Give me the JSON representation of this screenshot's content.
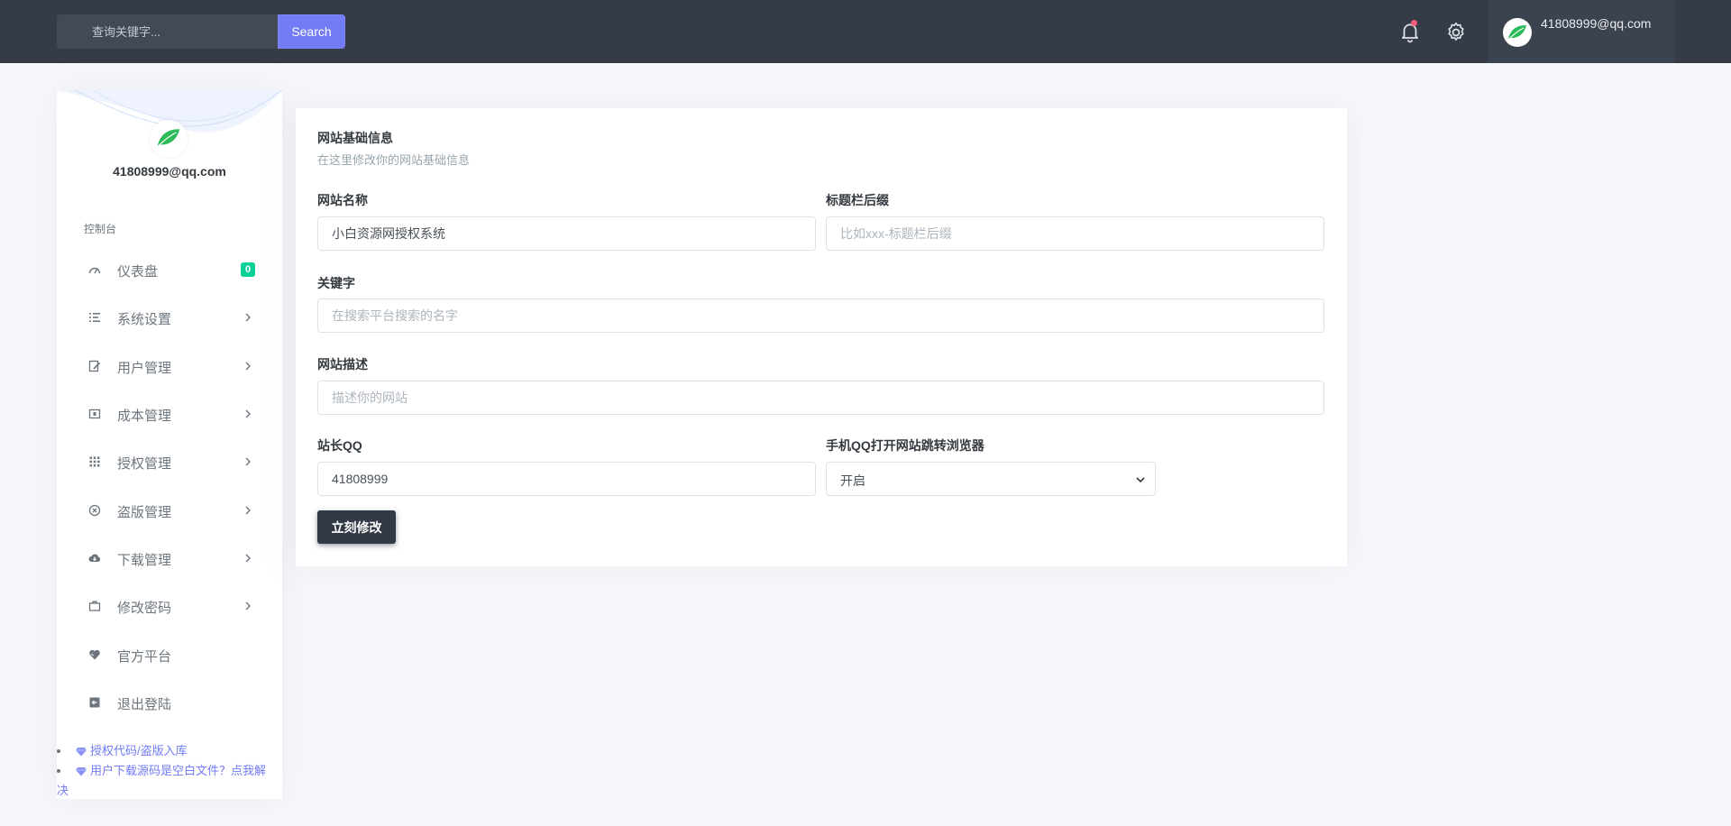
{
  "topbar": {
    "search_placeholder": "查询关键字...",
    "search_button": "Search",
    "user_email": "41808999@qq.com",
    "notification_icon": "bell-icon",
    "settings_icon": "gear-icon"
  },
  "sidebar": {
    "profile_name": "41808999@qq.com",
    "menu_title": "控制台",
    "items": [
      {
        "label": "仪表盘",
        "icon": "gauge-icon",
        "badge": "0"
      },
      {
        "label": "系统设置",
        "icon": "list-icon"
      },
      {
        "label": "用户管理",
        "icon": "edit-icon"
      },
      {
        "label": "成本管理",
        "icon": "cash-icon"
      },
      {
        "label": "授权管理",
        "icon": "grid-icon"
      },
      {
        "label": "盗版管理",
        "icon": "close-circle-icon"
      },
      {
        "label": "下载管理",
        "icon": "cloud-download-icon"
      },
      {
        "label": "修改密码",
        "icon": "briefcase-icon"
      },
      {
        "label": "官方平台",
        "icon": "heart-icon"
      },
      {
        "label": "退出登陆",
        "icon": "logout-icon"
      }
    ],
    "links": [
      {
        "text": "授权代码/盗版入库"
      },
      {
        "text_line1": "用户下载源码是空白文件？点我解",
        "text_line2": "决"
      }
    ]
  },
  "form": {
    "title": "网站基础信息",
    "subtitle": "在这里修改你的网站基础信息",
    "site_name": {
      "label": "网站名称",
      "value": "小白资源网授权系统"
    },
    "title_suffix": {
      "label": "标题栏后缀",
      "placeholder": "比如xxx-标题栏后缀"
    },
    "keywords": {
      "label": "关键字",
      "placeholder": "在搜索平台搜索的名字"
    },
    "description": {
      "label": "网站描述",
      "placeholder": "描述你的网站"
    },
    "owner_qq": {
      "label": "站长QQ",
      "value": "41808999"
    },
    "mobile_qq_redirect": {
      "label": "手机QQ打开网站跳转浏览器",
      "selected": "开启"
    },
    "submit_label": "立刻修改"
  },
  "colors": {
    "topbar": "#353c48",
    "primary": "#727cf5",
    "badge": "#0acf97",
    "submit": "#313a46",
    "avatar_leaf": "#2dbb5a"
  }
}
